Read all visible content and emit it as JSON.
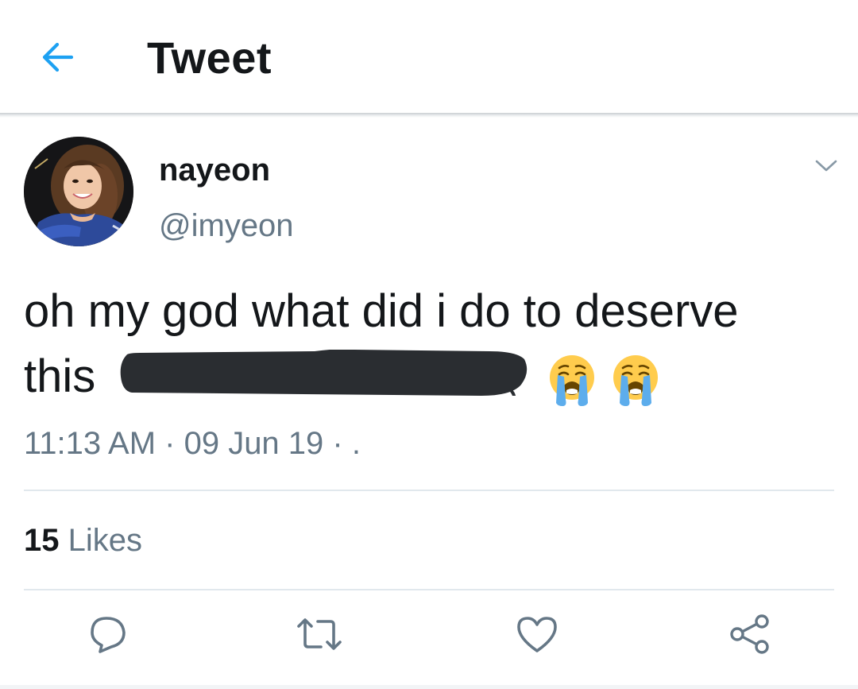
{
  "header": {
    "title": "Tweet",
    "back_icon": "arrow-left-icon",
    "accent_color": "#1da1f2"
  },
  "tweet": {
    "author": {
      "display_name": "nayeon",
      "handle": "@imyeon",
      "avatar_icon": "avatar-photo"
    },
    "text_line1": "oh my god what did i do to deserve",
    "text_line2": "this",
    "redacted": true,
    "emojis": [
      "loudly-crying-face",
      "loudly-crying-face"
    ],
    "timestamp": "11:13 AM · 09 Jun 19 · .",
    "likes": {
      "count": "15",
      "label": "Likes"
    }
  },
  "actions": [
    {
      "name": "reply",
      "icon": "reply-icon"
    },
    {
      "name": "retweet",
      "icon": "retweet-icon"
    },
    {
      "name": "like",
      "icon": "heart-icon"
    },
    {
      "name": "share",
      "icon": "share-icon"
    }
  ],
  "colors": {
    "text_primary": "#14171a",
    "text_secondary": "#657786",
    "divider": "#e1e8ed",
    "redaction": "#2a2d31"
  }
}
